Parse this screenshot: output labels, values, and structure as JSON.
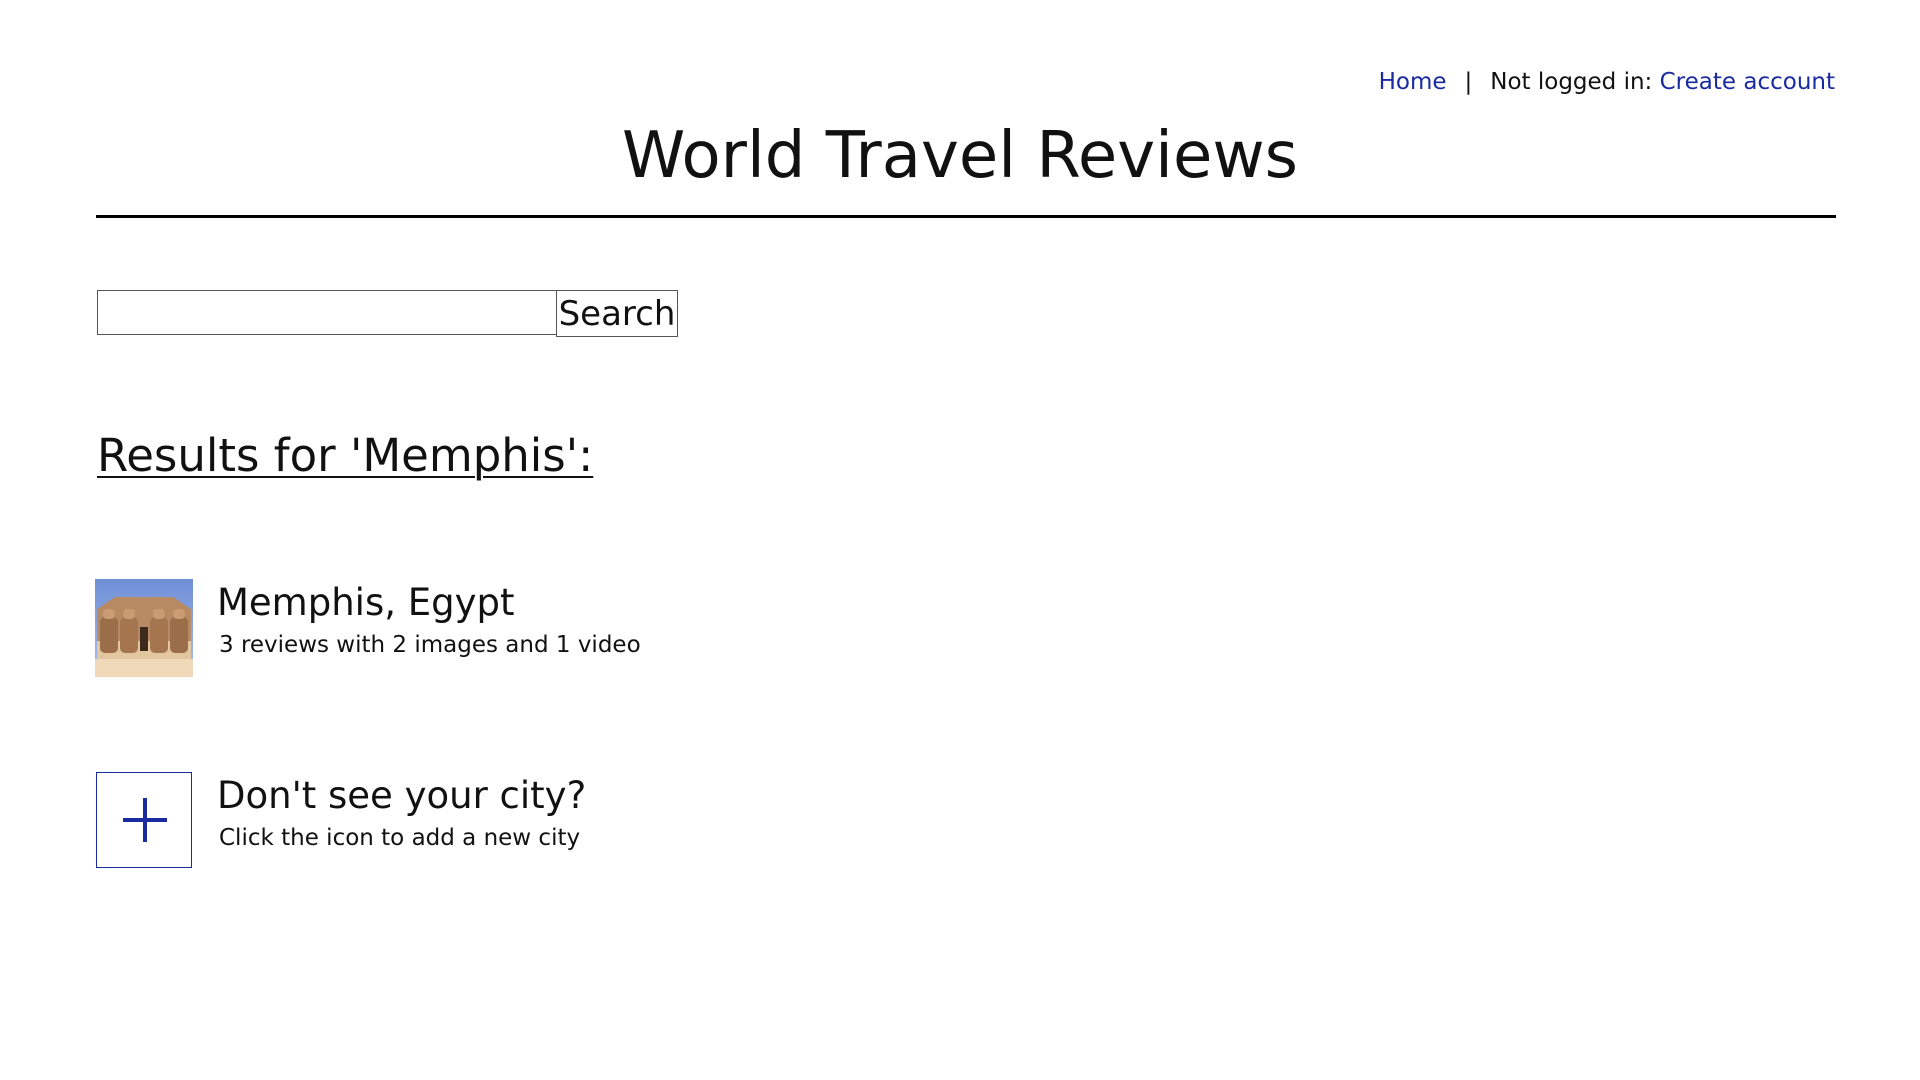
{
  "nav": {
    "home_label": "Home",
    "separator": "|",
    "status_text": "Not logged in:",
    "create_account_label": "Create account",
    "link_color": "#1a2aa0"
  },
  "site": {
    "title": "World Travel Reviews"
  },
  "search": {
    "input_value": "",
    "button_label": "Search"
  },
  "results": {
    "heading": "Results for 'Memphis':",
    "items": [
      {
        "title": "Memphis, Egypt",
        "subtitle": "3 reviews with 2 images and 1 video",
        "thumbnail_icon": "egyptian-temple-photo"
      }
    ]
  },
  "add_city": {
    "title": "Don't see your city?",
    "subtitle": "Click the icon to add a new city",
    "icon": "plus-icon"
  }
}
